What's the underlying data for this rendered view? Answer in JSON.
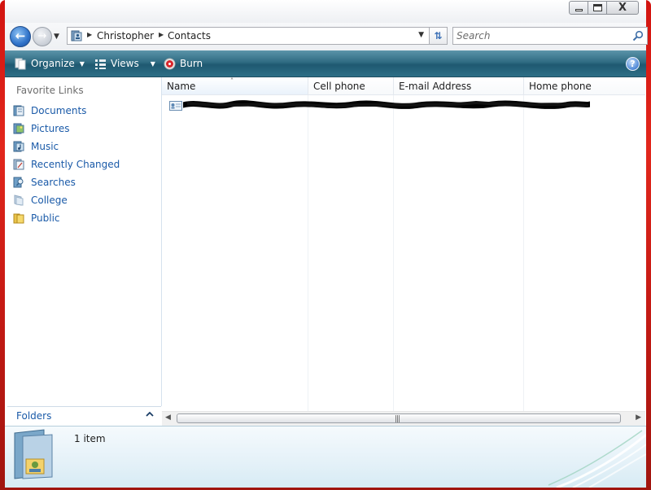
{
  "window": {
    "minimize_label": "",
    "maximize_label": "",
    "close_label": "X"
  },
  "address": {
    "crumbs": [
      "Christopher",
      "Contacts"
    ]
  },
  "search": {
    "placeholder": "Search"
  },
  "toolbar": {
    "organize_label": "Organize",
    "views_label": "Views",
    "burn_label": "Burn",
    "help_label": "?"
  },
  "navpane": {
    "heading": "Favorite Links",
    "items": [
      {
        "label": "Documents",
        "icon": "documents-icon"
      },
      {
        "label": "Pictures",
        "icon": "pictures-icon"
      },
      {
        "label": "Music",
        "icon": "music-icon"
      },
      {
        "label": "Recently Changed",
        "icon": "recently-changed-icon"
      },
      {
        "label": "Searches",
        "icon": "searches-icon"
      },
      {
        "label": "College",
        "icon": "college-folder-icon"
      },
      {
        "label": "Public",
        "icon": "public-folder-icon"
      }
    ],
    "folders_label": "Folders"
  },
  "columns": [
    "Name",
    "Cell phone",
    "E-mail Address",
    "Home phone"
  ],
  "details": {
    "item_count": "1 item"
  },
  "colors": {
    "frame": "#d21410",
    "command_bar": "#2f6b82",
    "link": "#1a5aa8"
  }
}
